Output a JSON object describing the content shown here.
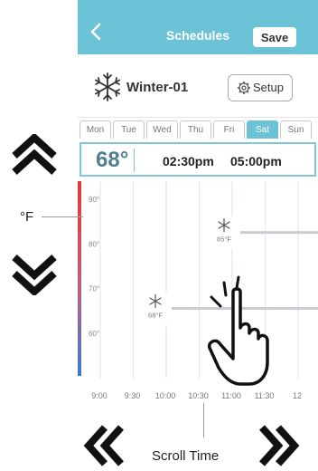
{
  "header": {
    "title": "Schedules",
    "back_icon": "chevron-left-icon",
    "save_label": "Save"
  },
  "schedule": {
    "name": "Winter-01",
    "icon": "snowflake-icon",
    "setup_label": "Setup",
    "setup_icon": "gear-icon"
  },
  "days": [
    {
      "label": "Mon",
      "active": false
    },
    {
      "label": "Tue",
      "active": false
    },
    {
      "label": "Wed",
      "active": false
    },
    {
      "label": "Thu",
      "active": false
    },
    {
      "label": "Fri",
      "active": false
    },
    {
      "label": "Sat",
      "active": true
    },
    {
      "label": "Sun",
      "active": false
    }
  ],
  "setpoint": {
    "temperature": "68°",
    "start": "02:30pm",
    "end": "05:00pm"
  },
  "chart_data": {
    "type": "line",
    "y_ticks": [
      "90°",
      "80°",
      "70°",
      "60°"
    ],
    "x_ticks": [
      "9:00",
      "9:30",
      "10:00",
      "10:30",
      "11:00",
      "11:30",
      "12"
    ],
    "points": [
      {
        "label": "85°F",
        "y": 85
      },
      {
        "label": "68°F",
        "y": 68
      }
    ]
  },
  "annotations": {
    "unit_label": "°F",
    "scroll_label": "Scroll Time",
    "up_icon": "double-chevron-up-icon",
    "down_icon": "double-chevron-down-icon",
    "left_icon": "double-chevron-left-icon",
    "right_icon": "double-chevron-right-icon",
    "hand_icon": "hand-pointer-icon"
  },
  "colors": {
    "accent": "#6cc3d8",
    "temp_text": "#4e7f92"
  }
}
